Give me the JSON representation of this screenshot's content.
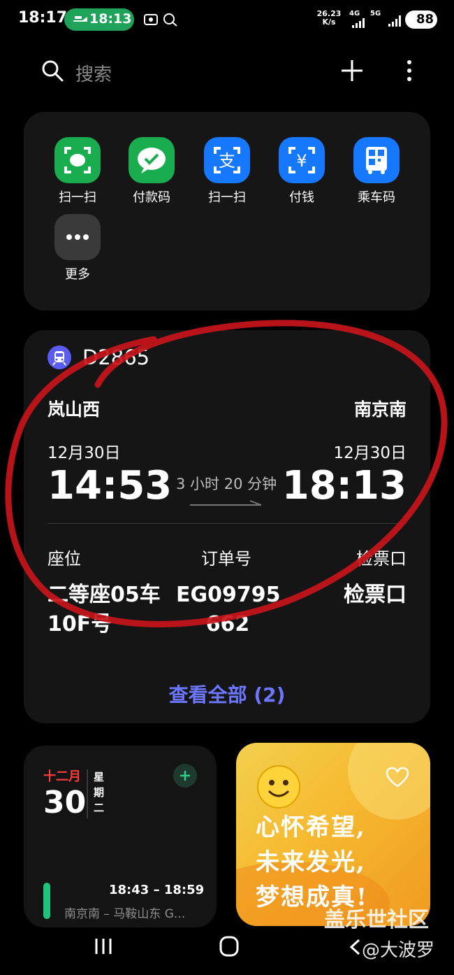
{
  "status_bar": {
    "time": "18:17",
    "pill_time": "18:13",
    "speed_value": "26.23",
    "speed_unit": "K/s",
    "net1": "4G",
    "net2": "5G",
    "battery": "88"
  },
  "search": {
    "placeholder": "搜索"
  },
  "apps": [
    {
      "label": "扫一扫",
      "icon": "wechat-scan-icon",
      "color": "#1aad4f"
    },
    {
      "label": "付款码",
      "icon": "wechat-pay-icon",
      "color": "#1aad4f"
    },
    {
      "label": "扫一扫",
      "icon": "alipay-scan-icon",
      "color": "#1677ff"
    },
    {
      "label": "付钱",
      "icon": "alipay-pay-icon",
      "color": "#1677ff"
    },
    {
      "label": "乘车码",
      "icon": "bus-code-icon",
      "color": "#1677ff"
    },
    {
      "label": "更多",
      "icon": "more-dots-icon",
      "color": "#3a3a3a"
    }
  ],
  "ticket": {
    "train_no": "D2865",
    "from_station": "岚山西",
    "to_station": "南京南",
    "from_date": "12月30日",
    "to_date": "12月30日",
    "depart_time": "14:53",
    "arrive_time": "18:13",
    "duration": "3 小时 20 分钟",
    "seat_label": "座位",
    "order_label": "订单号",
    "gate_label": "检票口",
    "seat_value_1": "二等座05车",
    "seat_value_2": "10F号",
    "order_value_1": "EG09795",
    "order_value_2": "662",
    "gate_value": "检票口",
    "see_all": "查看全部 (2)"
  },
  "calendar": {
    "month": "十二月",
    "day": "30",
    "weekday": [
      "星",
      "期",
      "二"
    ],
    "event_time": "18:43 – 18:59",
    "event_title": "南京南 – 马鞍山东 G..."
  },
  "quote": {
    "lines": [
      "心怀希望,",
      "未来发光,",
      "梦想成真!"
    ]
  },
  "watermark": {
    "line1": "盖乐世社区",
    "line2": "@大波罗"
  }
}
